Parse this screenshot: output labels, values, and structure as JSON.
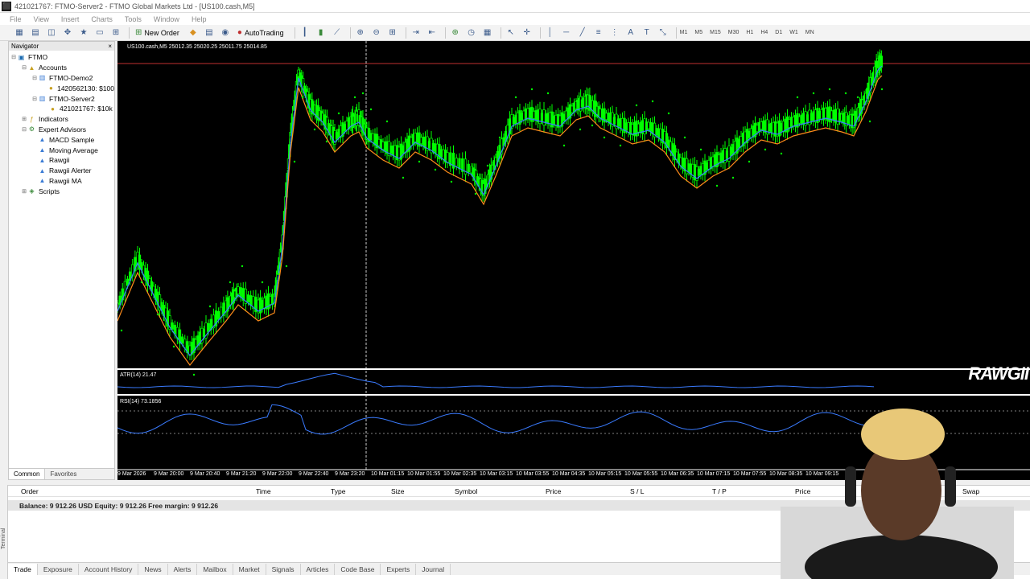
{
  "window": {
    "title": "421021767: FTMO-Server2 - FTMO Global Markets Ltd - [US100.cash,M5]"
  },
  "menu": [
    "File",
    "View",
    "Insert",
    "Charts",
    "Tools",
    "Window",
    "Help"
  ],
  "toolbar": {
    "new_order": "New Order",
    "auto_trading": "AutoTrading",
    "timeframes": [
      "M1",
      "M5",
      "M15",
      "M30",
      "H1",
      "H4",
      "D1",
      "W1",
      "MN"
    ]
  },
  "navigator": {
    "title": "Navigator",
    "items": [
      {
        "label": "FTMO",
        "level": 0,
        "icon": "terminal-icon"
      },
      {
        "label": "Accounts",
        "level": 1,
        "icon": "accounts-icon"
      },
      {
        "label": "FTMO-Demo2",
        "level": 2,
        "icon": "server-icon"
      },
      {
        "label": "1420562130: $100",
        "level": 3,
        "icon": "account-icon"
      },
      {
        "label": "FTMO-Server2",
        "level": 2,
        "icon": "server-icon"
      },
      {
        "label": "421021767: $10k",
        "level": 3,
        "icon": "account-icon"
      },
      {
        "label": "Indicators",
        "level": 1,
        "icon": "indicators-icon"
      },
      {
        "label": "Expert Advisors",
        "level": 1,
        "icon": "experts-icon"
      },
      {
        "label": "MACD Sample",
        "level": 2,
        "icon": "ea-icon"
      },
      {
        "label": "Moving Average",
        "level": 2,
        "icon": "ea-icon"
      },
      {
        "label": "Rawgii",
        "level": 2,
        "icon": "ea-icon"
      },
      {
        "label": "Rawgii Alerter",
        "level": 2,
        "icon": "ea-icon"
      },
      {
        "label": "Rawgii MA",
        "level": 2,
        "icon": "ea-icon"
      },
      {
        "label": "Scripts",
        "level": 1,
        "icon": "scripts-icon"
      }
    ],
    "tabs": [
      "Common",
      "Favorites"
    ]
  },
  "chart": {
    "symbol_label": "US100.cash,M5  25012.35 25020.25 25011.75 25014.85",
    "atr_label": "ATR(14) 21.47",
    "rsi_label": "RSI(14) 73.1856",
    "time_labels": [
      "9 Mar 2026",
      "9 Mar 20:00",
      "9 Mar 20:40",
      "9 Mar 21:20",
      "9 Mar 22:00",
      "9 Mar 22:40",
      "9 Mar 23:20",
      "10 Mar 01:15",
      "10 Mar 01:55",
      "10 Mar 02:35",
      "10 Mar 03:15",
      "10 Mar 03:55",
      "10 Mar 04:35",
      "10 Mar 05:15",
      "10 Mar 05:55",
      "10 Mar 06:35",
      "10 Mar 07:15",
      "10 Mar 07:55",
      "10 Mar 08:35",
      "10 Mar 09:15"
    ],
    "watermark": "RAWGII",
    "colors": {
      "bull": "#00ff00",
      "ma_fast": "#3a7bff",
      "ma_slow": "#ff8c1a",
      "sar": "#00ff00",
      "price_line": "#c03030",
      "indicator": "#3a7bff"
    }
  },
  "terminal": {
    "columns": [
      "Order",
      "Time",
      "Type",
      "Size",
      "Symbol",
      "Price",
      "S / L",
      "T / P",
      "Price",
      "Swap"
    ],
    "balance": "Balance: 9 912.26 USD  Equity: 9 912.26  Free margin: 9 912.26",
    "tabs": [
      "Trade",
      "Exposure",
      "Account History",
      "News",
      "Alerts",
      "Mailbox",
      "Market",
      "Signals",
      "Articles",
      "Code Base",
      "Experts",
      "Journal"
    ],
    "side_label": "Terminal"
  }
}
